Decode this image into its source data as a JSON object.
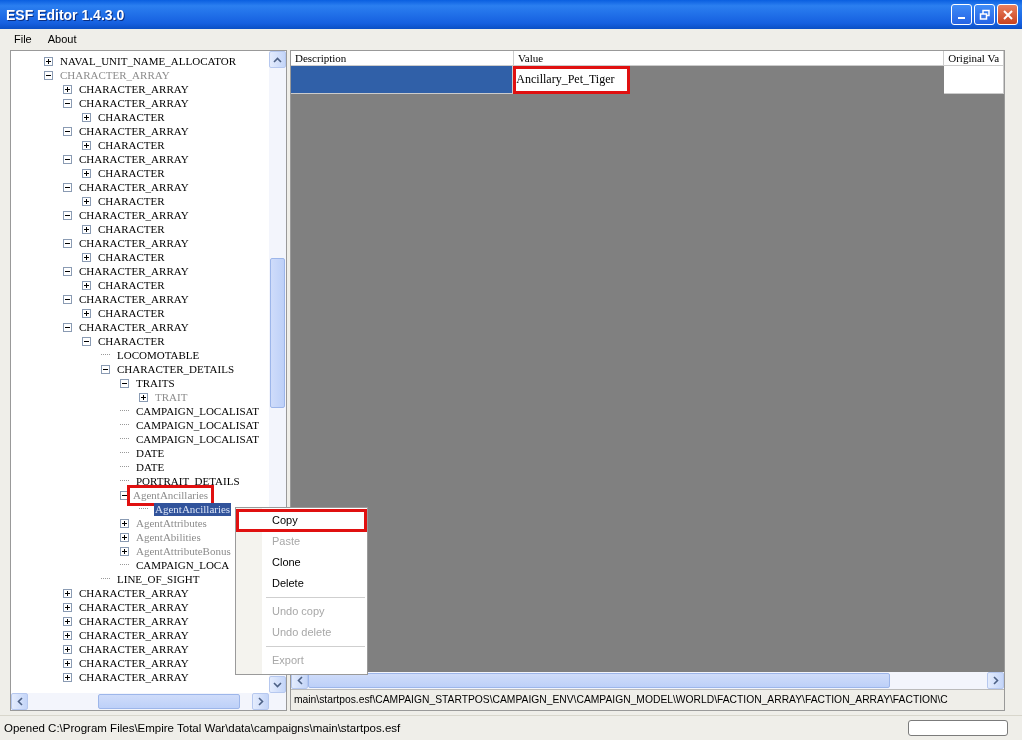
{
  "window": {
    "title": "ESF Editor 1.4.3.0"
  },
  "menu": [
    "File",
    "About"
  ],
  "tree": [
    {
      "label": "NAVAL_UNIT_NAME_ALLOCATOR",
      "expanded": false,
      "greyed": false,
      "selected": false,
      "highlighted": false
    },
    {
      "label": "CHARACTER_ARRAY",
      "expanded": true,
      "greyed": true,
      "selected": false,
      "highlighted": false,
      "children": [
        {
          "label": "CHARACTER_ARRAY",
          "expanded": false,
          "greyed": false,
          "selected": false,
          "highlighted": false
        },
        {
          "label": "CHARACTER_ARRAY",
          "expanded": true,
          "greyed": false,
          "selected": false,
          "highlighted": false,
          "children": [
            {
              "label": "CHARACTER",
              "expanded": false,
              "greyed": false,
              "selected": false,
              "highlighted": false
            }
          ]
        },
        {
          "label": "CHARACTER_ARRAY",
          "expanded": true,
          "greyed": false,
          "selected": false,
          "highlighted": false,
          "children": [
            {
              "label": "CHARACTER",
              "expanded": false,
              "greyed": false,
              "selected": false,
              "highlighted": false
            }
          ]
        },
        {
          "label": "CHARACTER_ARRAY",
          "expanded": true,
          "greyed": false,
          "selected": false,
          "highlighted": false,
          "children": [
            {
              "label": "CHARACTER",
              "expanded": false,
              "greyed": false,
              "selected": false,
              "highlighted": false
            }
          ]
        },
        {
          "label": "CHARACTER_ARRAY",
          "expanded": true,
          "greyed": false,
          "selected": false,
          "highlighted": false,
          "children": [
            {
              "label": "CHARACTER",
              "expanded": false,
              "greyed": false,
              "selected": false,
              "highlighted": false
            }
          ]
        },
        {
          "label": "CHARACTER_ARRAY",
          "expanded": true,
          "greyed": false,
          "selected": false,
          "highlighted": false,
          "children": [
            {
              "label": "CHARACTER",
              "expanded": false,
              "greyed": false,
              "selected": false,
              "highlighted": false
            }
          ]
        },
        {
          "label": "CHARACTER_ARRAY",
          "expanded": true,
          "greyed": false,
          "selected": false,
          "highlighted": false,
          "children": [
            {
              "label": "CHARACTER",
              "expanded": false,
              "greyed": false,
              "selected": false,
              "highlighted": false
            }
          ]
        },
        {
          "label": "CHARACTER_ARRAY",
          "expanded": true,
          "greyed": false,
          "selected": false,
          "highlighted": false,
          "children": [
            {
              "label": "CHARACTER",
              "expanded": false,
              "greyed": false,
              "selected": false,
              "highlighted": false
            }
          ]
        },
        {
          "label": "CHARACTER_ARRAY",
          "expanded": true,
          "greyed": false,
          "selected": false,
          "highlighted": false,
          "children": [
            {
              "label": "CHARACTER",
              "expanded": false,
              "greyed": false,
              "selected": false,
              "highlighted": false
            }
          ]
        },
        {
          "label": "CHARACTER_ARRAY",
          "expanded": true,
          "greyed": false,
          "selected": false,
          "highlighted": false,
          "children": [
            {
              "label": "CHARACTER",
              "expanded": true,
              "greyed": false,
              "selected": false,
              "highlighted": false,
              "children": [
                {
                  "label": "LOCOMOTABLE",
                  "greyed": false,
                  "selected": false,
                  "highlighted": false
                },
                {
                  "label": "CHARACTER_DETAILS",
                  "expanded": true,
                  "greyed": false,
                  "selected": false,
                  "highlighted": false,
                  "children": [
                    {
                      "label": "TRAITS",
                      "expanded": true,
                      "greyed": false,
                      "selected": false,
                      "highlighted": false,
                      "children": [
                        {
                          "label": "TRAIT",
                          "expanded": false,
                          "greyed": true,
                          "selected": false,
                          "highlighted": false
                        }
                      ]
                    },
                    {
                      "label": "CAMPAIGN_LOCALISAT",
                      "greyed": false,
                      "selected": false,
                      "highlighted": false
                    },
                    {
                      "label": "CAMPAIGN_LOCALISAT",
                      "greyed": false,
                      "selected": false,
                      "highlighted": false
                    },
                    {
                      "label": "CAMPAIGN_LOCALISAT",
                      "greyed": false,
                      "selected": false,
                      "highlighted": false
                    },
                    {
                      "label": "DATE",
                      "greyed": false,
                      "selected": false,
                      "highlighted": false
                    },
                    {
                      "label": "DATE",
                      "greyed": false,
                      "selected": false,
                      "highlighted": false
                    },
                    {
                      "label": "PORTRAIT_DETAILS",
                      "greyed": false,
                      "selected": false,
                      "highlighted": false
                    },
                    {
                      "label": "AgentAncillaries",
                      "expanded": true,
                      "greyed": true,
                      "selected": false,
                      "highlighted": true,
                      "children": [
                        {
                          "label": "AgentAncillaries",
                          "greyed": true,
                          "selected": true,
                          "highlighted": false
                        }
                      ]
                    },
                    {
                      "label": "AgentAttributes",
                      "expanded": false,
                      "greyed": true,
                      "selected": false,
                      "highlighted": false
                    },
                    {
                      "label": "AgentAbilities",
                      "expanded": false,
                      "greyed": true,
                      "selected": false,
                      "highlighted": false
                    },
                    {
                      "label": "AgentAttributeBonus",
                      "expanded": false,
                      "greyed": true,
                      "selected": false,
                      "highlighted": false
                    },
                    {
                      "label": "CAMPAIGN_LOCA",
                      "greyed": false,
                      "selected": false,
                      "highlighted": false
                    }
                  ]
                },
                {
                  "label": "LINE_OF_SIGHT",
                  "greyed": false,
                  "selected": false,
                  "highlighted": false
                }
              ]
            }
          ]
        },
        {
          "label": "CHARACTER_ARRAY",
          "expanded": false,
          "greyed": false,
          "selected": false,
          "highlighted": false
        },
        {
          "label": "CHARACTER_ARRAY",
          "expanded": false,
          "greyed": false,
          "selected": false,
          "highlighted": false
        },
        {
          "label": "CHARACTER_ARRAY",
          "expanded": false,
          "greyed": false,
          "selected": false,
          "highlighted": false
        },
        {
          "label": "CHARACTER_ARRAY",
          "expanded": false,
          "greyed": false,
          "selected": false,
          "highlighted": false
        },
        {
          "label": "CHARACTER_ARRAY",
          "expanded": false,
          "greyed": false,
          "selected": false,
          "highlighted": false
        },
        {
          "label": "CHARACTER_ARRAY",
          "expanded": false,
          "greyed": false,
          "selected": false,
          "highlighted": false
        },
        {
          "label": "CHARACTER_ARRAY",
          "expanded": false,
          "greyed": false,
          "selected": false,
          "highlighted": false
        }
      ]
    }
  ],
  "grid": {
    "columns": [
      "Description",
      "Value",
      "Original Va"
    ],
    "rows": [
      {
        "selected": true,
        "cells": [
          {
            "text": "",
            "highlighted": false
          },
          {
            "text": "Ancillary_Pet_Tiger",
            "highlighted": true
          },
          {
            "text": "",
            "highlighted": false
          }
        ]
      }
    ]
  },
  "path": "main\\startpos.esf\\CAMPAIGN_STARTPOS\\CAMPAIGN_ENV\\CAMPAIGN_MODEL\\WORLD\\FACTION_ARRAY\\FACTION_ARRAY\\FACTION\\C",
  "context_menu": [
    {
      "kind": "item",
      "label": "Copy",
      "disabled": false,
      "highlighted": true
    },
    {
      "kind": "item",
      "label": "Paste",
      "disabled": true,
      "highlighted": false
    },
    {
      "kind": "item",
      "label": "Clone",
      "disabled": false,
      "highlighted": false
    },
    {
      "kind": "item",
      "label": "Delete",
      "disabled": false,
      "highlighted": false
    },
    {
      "kind": "separator"
    },
    {
      "kind": "item",
      "label": "Undo copy",
      "disabled": true,
      "highlighted": false
    },
    {
      "kind": "item",
      "label": "Undo delete",
      "disabled": true,
      "highlighted": false
    },
    {
      "kind": "separator"
    },
    {
      "kind": "item",
      "label": "Export",
      "disabled": true,
      "highlighted": false
    }
  ],
  "status_bar": {
    "text": "Opened C:\\Program Files\\Empire Total War\\data\\campaigns\\main\\startpos.esf"
  }
}
